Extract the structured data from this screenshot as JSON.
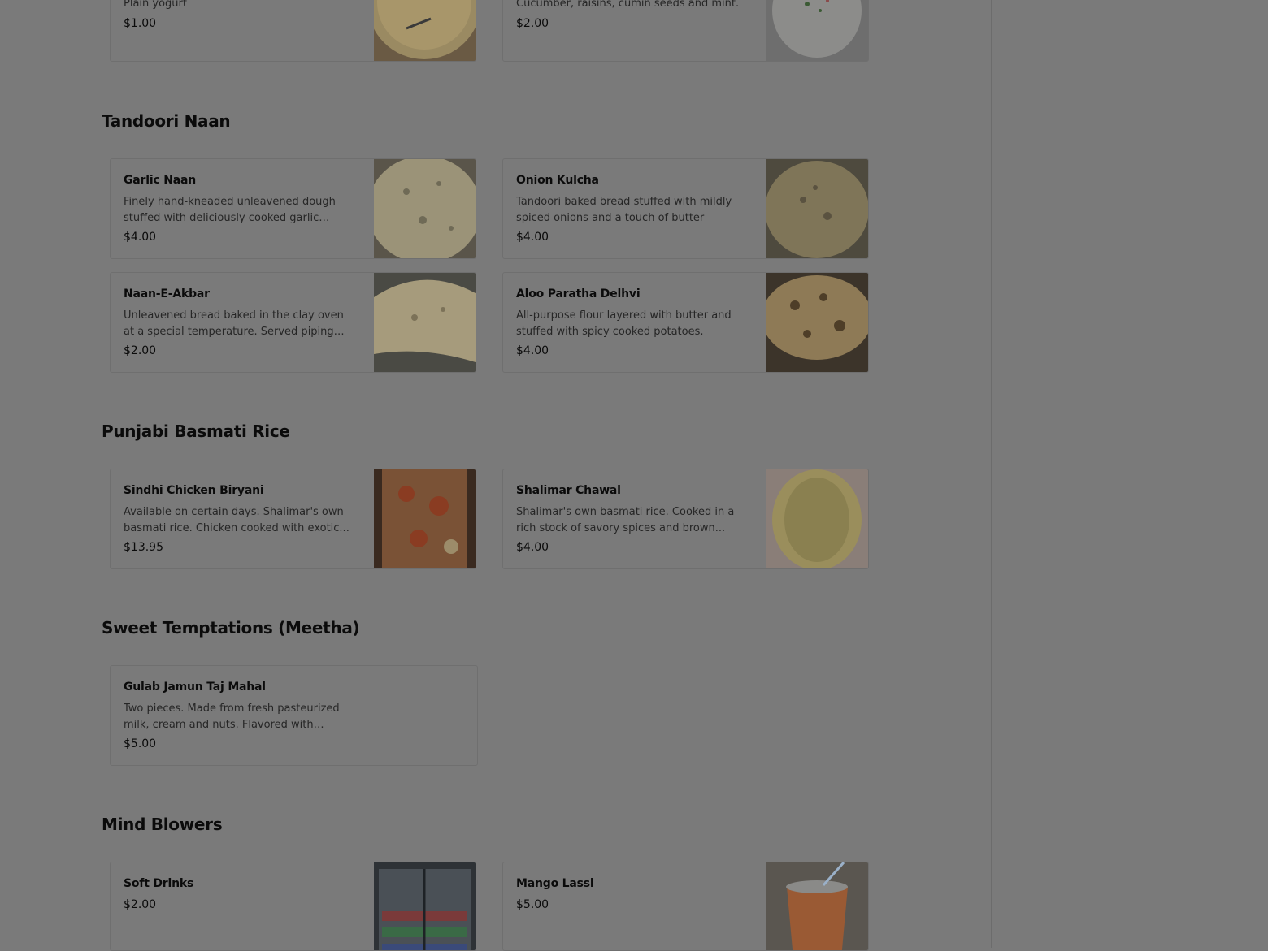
{
  "top_cards": [
    {
      "description": "Plain yogurt",
      "price": "$1.00"
    },
    {
      "description": "Cucumber, raisins, cumin seeds and mint.",
      "price": "$2.00"
    }
  ],
  "sections": [
    {
      "title": "Tandoori Naan",
      "items": [
        {
          "name": "Garlic Naan",
          "description": "Finely hand-kneaded unleavened dough stuffed with deliciously cooked garlic and...",
          "price": "$4.00"
        },
        {
          "name": "Onion Kulcha",
          "description": "Tandoori baked bread stuffed with mildly spiced onions and a touch of butter",
          "price": "$4.00"
        },
        {
          "name": "Naan-E-Akbar",
          "description": "Unleavened bread baked in the clay oven at a special temperature. Served piping hot.",
          "price": "$2.00"
        },
        {
          "name": "Aloo Paratha Delhvi",
          "description": "All-purpose flour layered with butter and stuffed with spicy cooked potatoes.",
          "price": "$4.00"
        }
      ]
    },
    {
      "title": "Punjabi Basmati Rice",
      "items": [
        {
          "name": "Sindhi Chicken Biryani",
          "description": "Available on certain days. Shalimar's own basmati rice. Chicken cooked with exotic...",
          "price": "$13.95"
        },
        {
          "name": "Shalimar Chawal",
          "description": "Shalimar's own basmati rice. Cooked in a rich stock of savory spices and brown...",
          "price": "$4.00"
        }
      ]
    },
    {
      "title": "Sweet Temptations (Meetha)",
      "items": [
        {
          "name": "Gulab Jamun Taj Mahal",
          "description": "Two pieces. Made from fresh pasteurized milk, cream and nuts. Flavored with crush...",
          "price": "$5.00"
        }
      ]
    },
    {
      "title": "Mind Blowers",
      "items": [
        {
          "name": "Soft Drinks",
          "price": "$2.00"
        },
        {
          "name": "Mango Lassi",
          "price": "$5.00"
        }
      ]
    }
  ],
  "colors": {
    "overlay_background": "#7a7a7a",
    "text_primary": "#0b0b0b",
    "text_secondary": "#262626"
  }
}
